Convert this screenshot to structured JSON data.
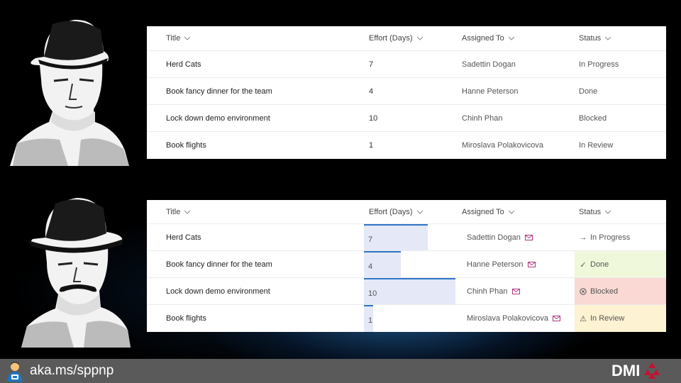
{
  "lists": {
    "columns": {
      "title": "Title",
      "effort": "Effort (Days)",
      "assigned": "Assigned To",
      "status": "Status"
    },
    "rows": [
      {
        "title": "Herd Cats",
        "effort": "7",
        "effort_value": 7,
        "assigned": "Sadettin Dogan",
        "status": "In Progress"
      },
      {
        "title": "Book fancy dinner for the team",
        "effort": "4",
        "effort_value": 4,
        "assigned": "Hanne Peterson",
        "status": "Done"
      },
      {
        "title": "Lock down demo environment",
        "effort": "10",
        "effort_value": 10,
        "assigned": "Chinh Phan",
        "status": "Blocked"
      },
      {
        "title": "Book flights",
        "effort": "1",
        "effort_value": 1,
        "assigned": "Miroslava Polakovicova",
        "status": "In Review"
      }
    ],
    "effort_max": 10
  },
  "status_styles": {
    "In Progress": {
      "icon": "arrow-right-icon",
      "bg": "#ffffff"
    },
    "Done": {
      "icon": "checkmark-icon",
      "bg": "#f0f8dc"
    },
    "Blocked": {
      "icon": "blocked-circle-icon",
      "bg": "#fad9d4"
    },
    "In Review": {
      "icon": "warning-icon",
      "bg": "#fdf2d2"
    }
  },
  "colors": {
    "accent": "#2e75c7",
    "effort_fill": "#e4e8f7",
    "mail": "#b1367d",
    "brand_red": "#c8102e"
  },
  "footer": {
    "url": "aka.ms/sppnp",
    "brand": "DMI"
  }
}
